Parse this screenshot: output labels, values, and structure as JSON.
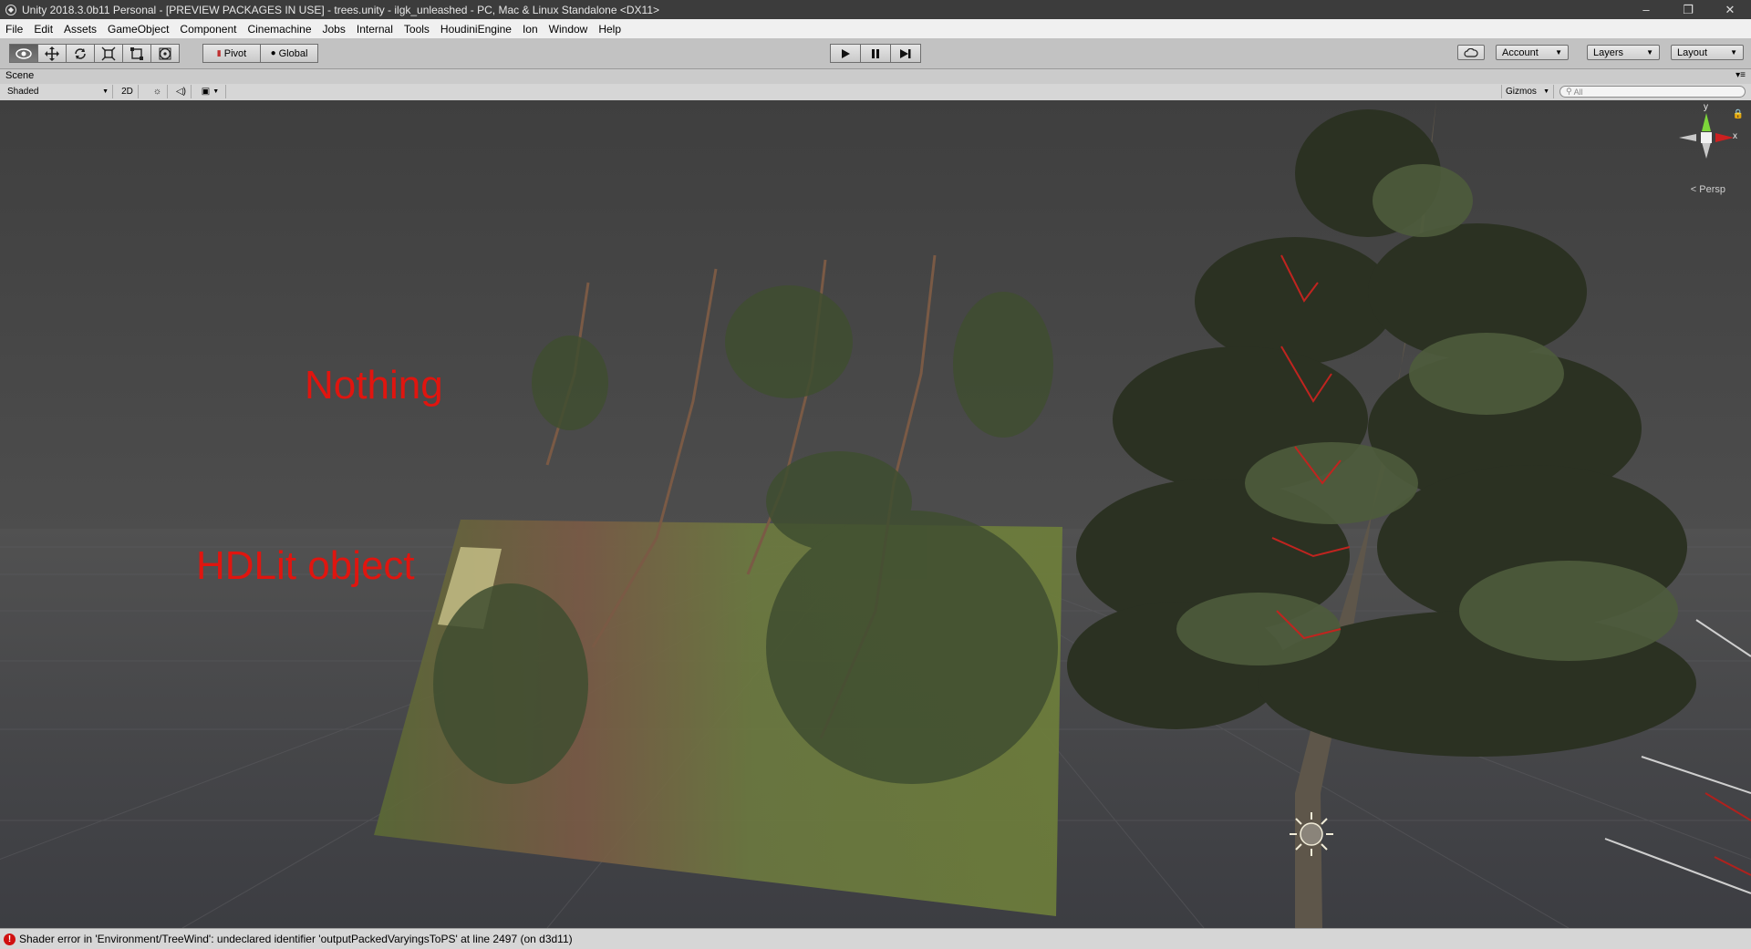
{
  "window": {
    "title": "Unity 2018.3.0b11 Personal - [PREVIEW PACKAGES IN USE] - trees.unity - ilgk_unleashed - PC, Mac & Linux Standalone <DX11>",
    "minimize_glyph": "–",
    "maximize_glyph": "❐",
    "close_glyph": "✕"
  },
  "menu": [
    "File",
    "Edit",
    "Assets",
    "GameObject",
    "Component",
    "Cinemachine",
    "Jobs",
    "Internal",
    "Tools",
    "HoudiniEngine",
    "Ion",
    "Window",
    "Help"
  ],
  "toolbar": {
    "pivot_label": "Pivot",
    "global_label": "Global",
    "account_label": "Account",
    "layers_label": "Layers",
    "layout_label": "Layout"
  },
  "scene_tab": {
    "label": "Scene",
    "shading_mode": "Shaded",
    "mode_2d": "2D",
    "gizmos_label": "Gizmos",
    "search_placeholder": "All"
  },
  "viewport": {
    "label_nothing": "Nothing",
    "label_hdlit": "HDLit object",
    "gizmo_y": "y",
    "gizmo_x": "x",
    "persp_label": "Persp"
  },
  "status": {
    "message": "Shader error in 'Environment/TreeWind': undeclared identifier 'outputPackedVaryingsToPS' at line 2497 (on d3d11)"
  },
  "colors": {
    "error_red": "#e0150f",
    "viewport_bg": "#464646"
  }
}
